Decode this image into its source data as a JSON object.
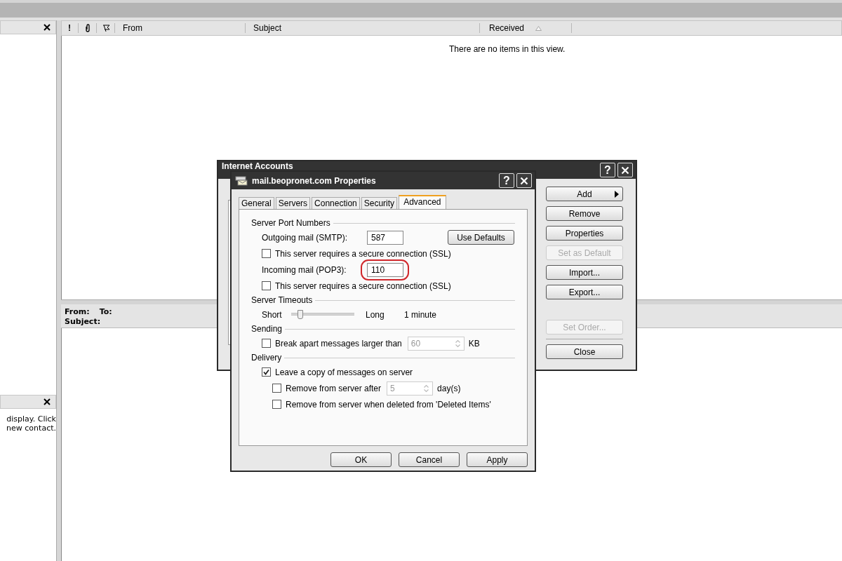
{
  "contacts_pane": {
    "text_lines": [
      "display. Click",
      "new contact."
    ]
  },
  "message_list": {
    "columns": [
      {
        "kind": "importance",
        "label": "!"
      },
      {
        "kind": "attachment"
      },
      {
        "kind": "flag"
      },
      {
        "kind": "text",
        "label": "From",
        "sorted": false
      },
      {
        "kind": "text",
        "label": "Subject",
        "sorted": false
      },
      {
        "kind": "text",
        "label": "Received",
        "sorted": true
      },
      {
        "kind": "blank"
      }
    ],
    "empty_text": "There are no items in this view."
  },
  "preview_header": {
    "from_label": "From:",
    "to_label": "To:",
    "subject_label": "Subject:"
  },
  "accounts_dialog": {
    "title": "Internet Accounts",
    "help": "?",
    "side_buttons": [
      {
        "label": "Add",
        "disabled": false,
        "menu": true
      },
      {
        "label": "Remove",
        "disabled": false,
        "menu": false
      },
      {
        "label": "Properties",
        "disabled": false,
        "menu": false
      },
      {
        "label": "Set as Default",
        "disabled": true,
        "menu": false
      },
      {
        "label": "Import...",
        "disabled": false,
        "menu": false
      },
      {
        "label": "Export...",
        "disabled": false,
        "menu": false
      }
    ],
    "order_button": {
      "label": "Set Order...",
      "disabled": true
    },
    "close_button": {
      "label": "Close",
      "disabled": false
    }
  },
  "properties_dialog": {
    "title": "mail.beopronet.com Properties",
    "help": "?",
    "tabs": [
      {
        "label": "General",
        "selected": false
      },
      {
        "label": "Servers",
        "selected": false
      },
      {
        "label": "Connection",
        "selected": false
      },
      {
        "label": "Security",
        "selected": false
      },
      {
        "label": "Advanced",
        "selected": true
      }
    ],
    "sections": [
      {
        "title": "Server Port Numbers",
        "rows": [
          {
            "kind": "port",
            "label": "Outgoing mail (SMTP):",
            "value": "587",
            "button": "Use Defaults"
          },
          {
            "kind": "checkbox",
            "label": "This server requires a secure connection (SSL)",
            "checked": false
          },
          {
            "kind": "port",
            "label": "Incoming mail (POP3):",
            "value": "110",
            "highlighted": true
          },
          {
            "kind": "checkbox",
            "label": "This server requires a secure connection (SSL)",
            "checked": false
          }
        ]
      },
      {
        "title": "Server Timeouts",
        "rows": [
          {
            "kind": "slider",
            "min_label": "Short",
            "max_label": "Long",
            "level": 0.1,
            "reading": "1 minute"
          }
        ]
      },
      {
        "title": "Sending",
        "rows": [
          {
            "kind": "spin",
            "label": "Break apart messages larger than",
            "checked": false,
            "value": "60",
            "unit": "KB",
            "disabled": true
          }
        ]
      },
      {
        "title": "Delivery",
        "rows": [
          {
            "kind": "checkbox",
            "label": "Leave a copy of messages on server",
            "checked": true,
            "children": [
              {
                "kind": "spin",
                "label": "Remove from server after",
                "checked": false,
                "value": "5",
                "unit": "day(s)",
                "disabled": true
              },
              {
                "kind": "checkbox",
                "label": "Remove from server when deleted from 'Deleted Items'",
                "checked": false
              }
            ]
          }
        ]
      }
    ],
    "buttons": [
      {
        "label": "OK"
      },
      {
        "label": "Cancel"
      },
      {
        "label": "Apply"
      }
    ]
  }
}
